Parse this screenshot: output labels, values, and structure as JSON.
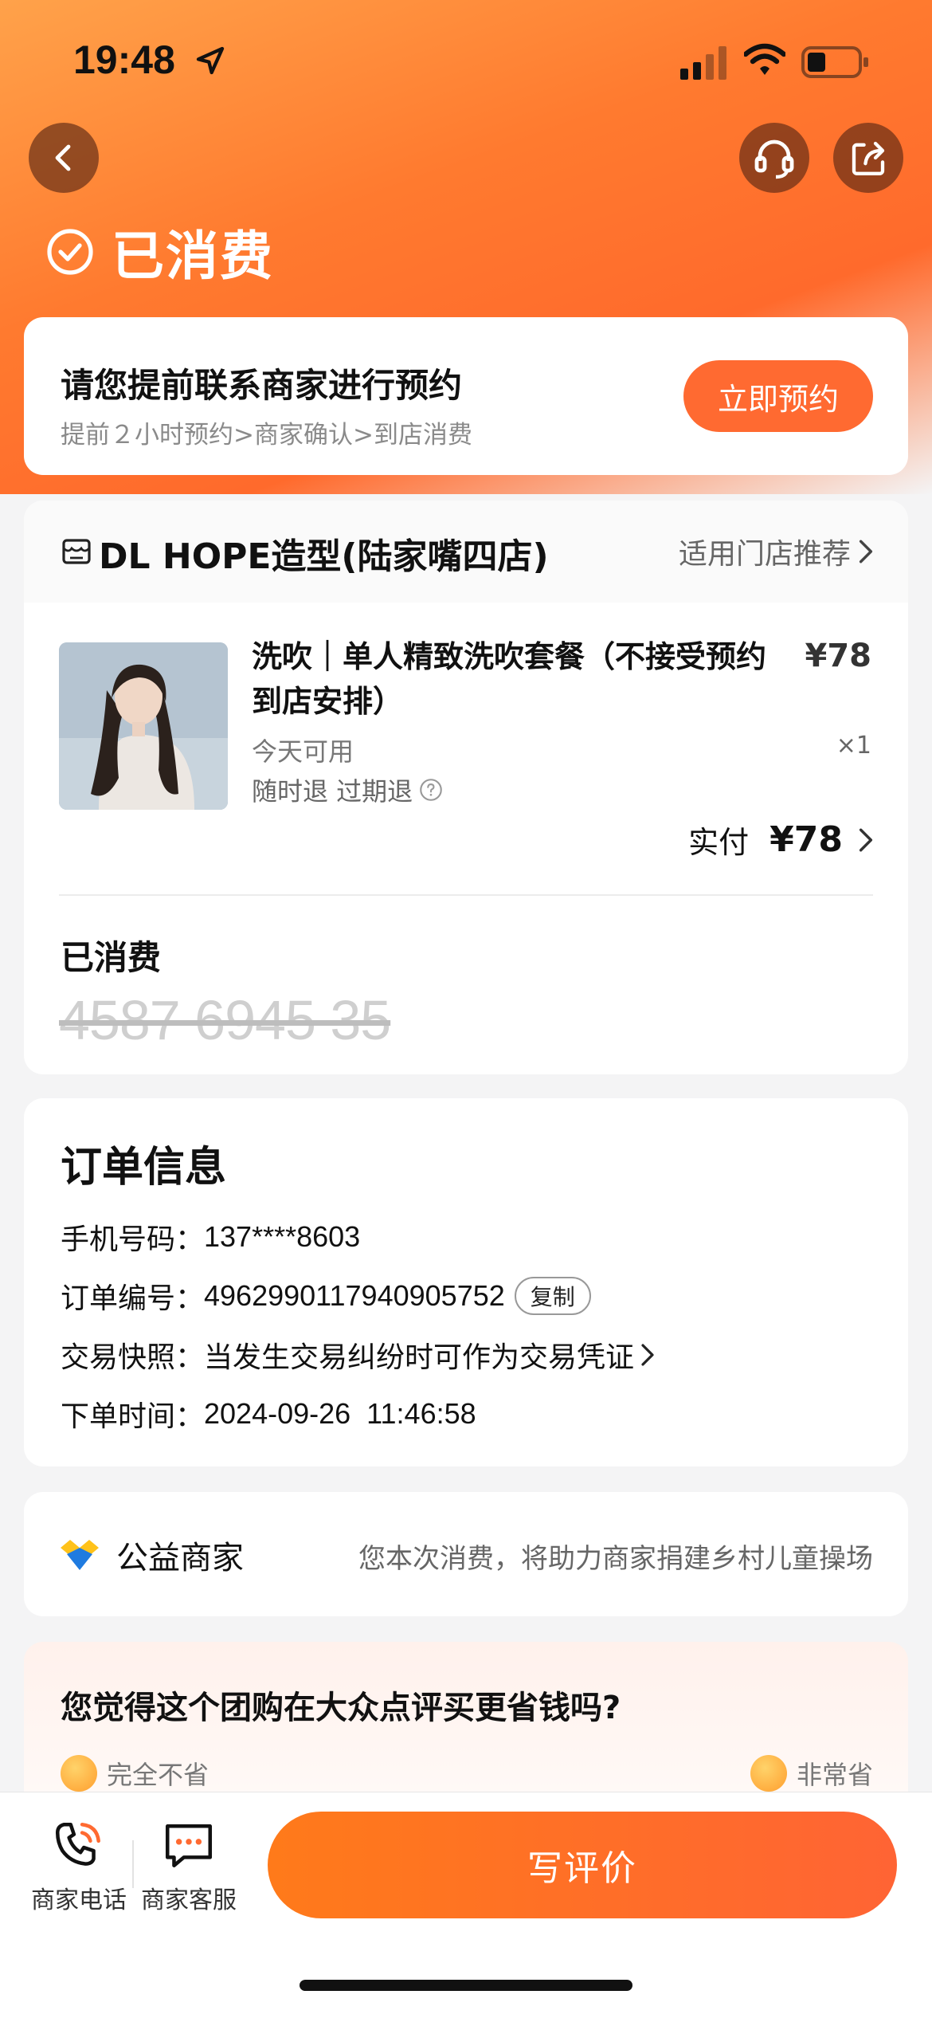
{
  "status_bar": {
    "time": "19:48"
  },
  "header": {
    "status_title": "已消费"
  },
  "reserve": {
    "title": "请您提前联系商家进行预约",
    "subtitle": "提前２小时预约>商家确认>到店消费",
    "button": "立即预约"
  },
  "shop": {
    "name": "DL HOPE造型(陆家嘴四店)",
    "link": "适用门店推荐"
  },
  "product": {
    "name": "洗吹｜单人精致洗吹套餐（不接受预约到店安排）",
    "price": "¥78",
    "quantity": "×1",
    "availability": "今天可用",
    "refund": "随时退 过期退",
    "paid_label": "实付",
    "paid_amount": "¥78"
  },
  "voucher": {
    "status": "已消费",
    "code": "4587 6945 35"
  },
  "order_info": {
    "title": "订单信息",
    "phone_label": "手机号码：",
    "phone": "137****8603",
    "order_no_label": "订单编号：",
    "order_no": "4962990117940905752",
    "copy": "复制",
    "snapshot_label": "交易快照：",
    "snapshot_text": "当发生交易纠纷时可作为交易凭证",
    "time_label": "下单时间：",
    "time": "2024-09-26  11:46:58"
  },
  "charity": {
    "label": "公益商家",
    "desc": "您本次消费，将助力商家捐建乡村儿童操场"
  },
  "survey": {
    "question": "您觉得这个团购在大众点评买更省钱吗?",
    "left_option": "完全不省",
    "right_option": "非常省"
  },
  "bottom_bar": {
    "phone_label": "商家电话",
    "service_label": "商家客服",
    "review_button": "写评价"
  },
  "colors": {
    "accent": "#ff6a31",
    "header_gradient_start": "#ffa24a",
    "header_gradient_end": "#ff6a2c"
  }
}
